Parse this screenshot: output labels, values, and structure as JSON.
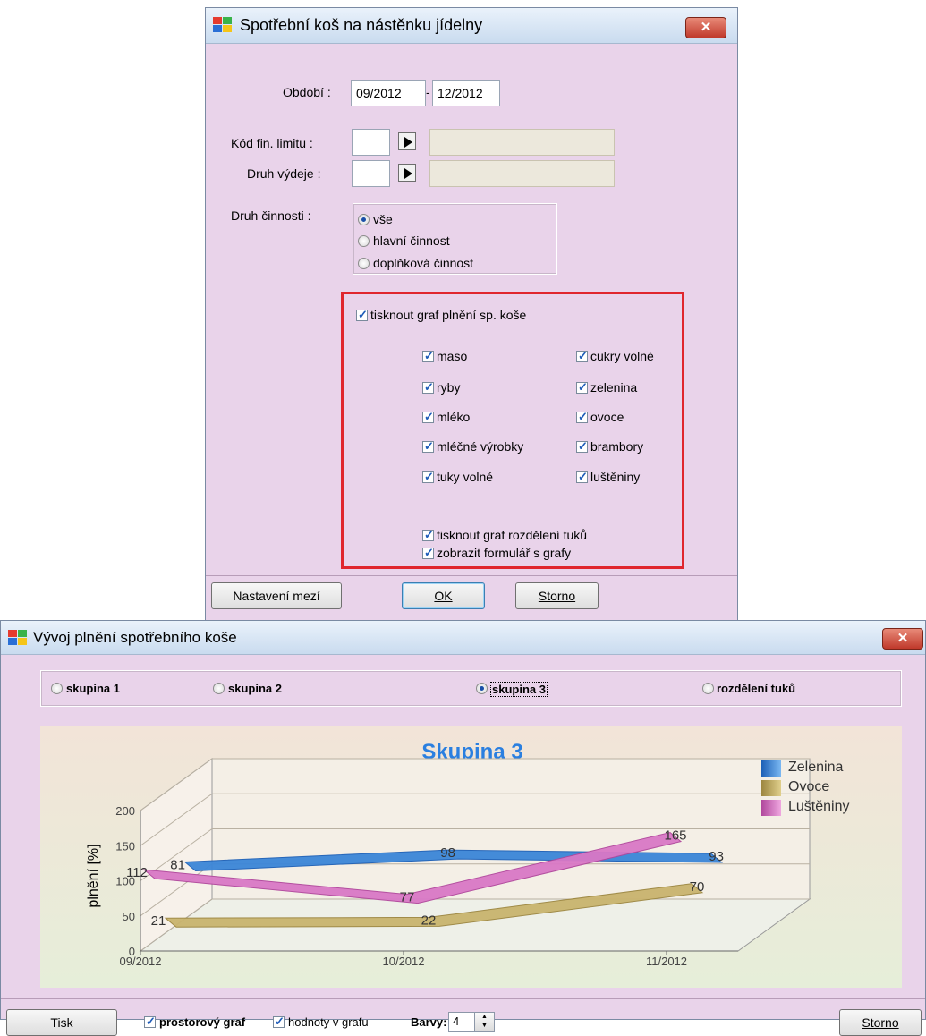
{
  "dialog1": {
    "title": "Spotřební koš na nástěnku jídelny",
    "close_label": "✕",
    "period_label": "Období :",
    "period_from": "09/2012",
    "period_sep": "-",
    "period_to": "12/2012",
    "fin_limit_label": "Kód fin. limitu :",
    "fin_limit_code": "",
    "fin_limit_name": "",
    "issue_type_label": "Druh výdeje :",
    "issue_type_code": "",
    "issue_type_name": "",
    "activity_label": "Druh činnosti :",
    "activity_options": [
      {
        "label": "vše",
        "selected": true
      },
      {
        "label": "hlavní činnost",
        "selected": false
      },
      {
        "label": "doplňková činnost",
        "selected": false
      }
    ],
    "print_chart_label": "tisknout graf plnění sp. koše",
    "categories_left": [
      {
        "label": "maso",
        "checked": true
      },
      {
        "label": "ryby",
        "checked": true
      },
      {
        "label": "mléko",
        "checked": true
      },
      {
        "label": "mléčné výrobky",
        "checked": true
      },
      {
        "label": "tuky volné",
        "checked": true
      }
    ],
    "categories_right": [
      {
        "label": "cukry volné",
        "checked": true
      },
      {
        "label": "zelenina",
        "checked": true
      },
      {
        "label": "ovoce",
        "checked": true
      },
      {
        "label": "brambory",
        "checked": true
      },
      {
        "label": "luštěniny",
        "checked": true
      }
    ],
    "print_fat_chart_label": "tisknout graf rozdělení tuků",
    "show_form_label": "zobrazit formulář s grafy",
    "buttons": {
      "limits": "Nastavení mezí",
      "ok": "OK",
      "cancel": "Storno"
    }
  },
  "dialog2": {
    "title": "Vývoj plnění spotřebního koše",
    "close_label": "✕",
    "groups": [
      {
        "label": "skupina 1",
        "selected": false
      },
      {
        "label": "skupina 2",
        "selected": false
      },
      {
        "label": "skupina 3",
        "selected": true
      },
      {
        "label": "rozdělení tuků",
        "selected": false
      }
    ],
    "footer": {
      "print": "Tisk",
      "spatial_chart": "prostorový graf",
      "values_in_chart": "hodnoty v grafu",
      "colors_label": "Barvy:",
      "colors_value": "4",
      "cancel": "Storno"
    }
  },
  "chart_data": {
    "type": "line",
    "title": "Skupina 3",
    "ylabel": "plnění [%]",
    "xlabel": "",
    "ylim": [
      0,
      200
    ],
    "yticks": [
      "0",
      "50",
      "100",
      "150",
      "200"
    ],
    "categories": [
      "09/2012",
      "10/2012",
      "11/2012"
    ],
    "series": [
      {
        "name": "Zelenina",
        "values": [
          81,
          98,
          93
        ],
        "color": "#3b86d8"
      },
      {
        "name": "Ovoce",
        "values": [
          21,
          22,
          70
        ],
        "color": "#c9b46e"
      },
      {
        "name": "Luštěniny",
        "values": [
          112,
          77,
          165
        ],
        "color": "#d978c6"
      }
    ],
    "three_d": true,
    "legend_position": "right"
  }
}
